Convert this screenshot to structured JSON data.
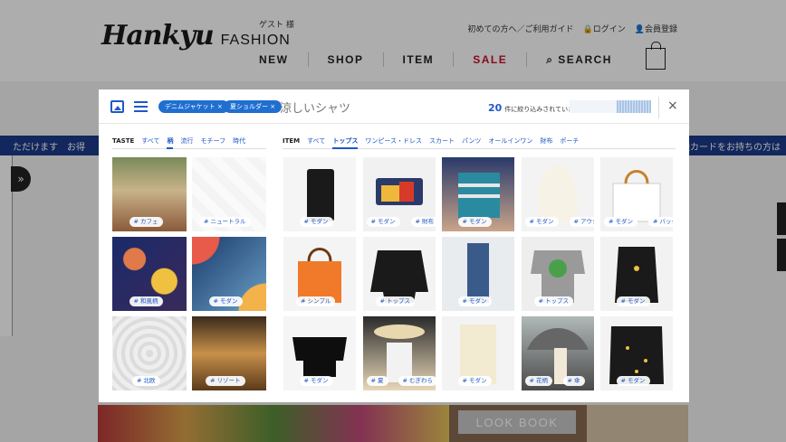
{
  "header": {
    "guest": "ゲスト 様",
    "util": [
      "初めての方へ／ご利用ガイド",
      "ログイン",
      "会員登録"
    ],
    "nav": [
      "NEW",
      "SHOP",
      "ITEM",
      "SALE",
      "SEARCH"
    ],
    "logo_script": "Hankyu",
    "logo_sub": "FASHION"
  },
  "ticker": {
    "left": "ただけます　お得",
    "right": "種カードをお持ちの方は"
  },
  "lookbook": "LOOK BOOK",
  "modal": {
    "chips": [
      "デニムジャケット ×",
      "夏ショルダー ×"
    ],
    "query": "涼しいシャツ",
    "count": "20",
    "count_text": "件に絞り込みされています",
    "progress": 0.42,
    "close": "×",
    "taste_tabs": {
      "head": "TASTE",
      "items": [
        "すべて",
        "柄",
        "流行",
        "モチーフ",
        "時代"
      ],
      "active": 1
    },
    "item_tabs": {
      "head": "ITEM",
      "items": [
        "すべて",
        "トップス",
        "ワンピース・ドレス",
        "スカート",
        "パンツ",
        "オールインワン",
        "財布",
        "ポーチ"
      ],
      "active": 1
    },
    "taste_tiles": [
      {
        "tags": [
          "# カフェ"
        ]
      },
      {
        "tags": [
          "# ニュートラル"
        ]
      },
      {
        "tags": [
          "# 和風柄"
        ]
      },
      {
        "tags": [
          "# モダン"
        ]
      },
      {
        "tags": [
          "# 北欧"
        ]
      },
      {
        "tags": [
          "# リゾート"
        ]
      }
    ],
    "item_tiles": [
      {
        "tags": [
          "# モダン"
        ]
      },
      {
        "tags": [
          "# モダン",
          "# 財布"
        ]
      },
      {
        "tags": [
          "# モダン"
        ]
      },
      {
        "tags": [
          "# モダン",
          "# アウター"
        ]
      },
      {
        "tags": [
          "# モダン",
          "# バッグ"
        ]
      },
      {
        "tags": [
          "# シンプル"
        ]
      },
      {
        "tags": [
          "# トップス"
        ]
      },
      {
        "tags": [
          "# モダン"
        ]
      },
      {
        "tags": [
          "# トップス"
        ]
      },
      {
        "tags": [
          "# モダン"
        ]
      },
      {
        "tags": [
          "# モダン"
        ]
      },
      {
        "tags": [
          "# 夏",
          "# むぎわら"
        ]
      },
      {
        "tags": [
          "# モダン"
        ]
      },
      {
        "tags": [
          "# 花柄",
          "# 傘"
        ]
      },
      {
        "tags": [
          "# モダン"
        ]
      }
    ]
  },
  "colors": {
    "accent": "#1f58c7",
    "chip": "#1f6fd0",
    "sale": "#c8102e",
    "ticker": "#1a3a8a"
  }
}
